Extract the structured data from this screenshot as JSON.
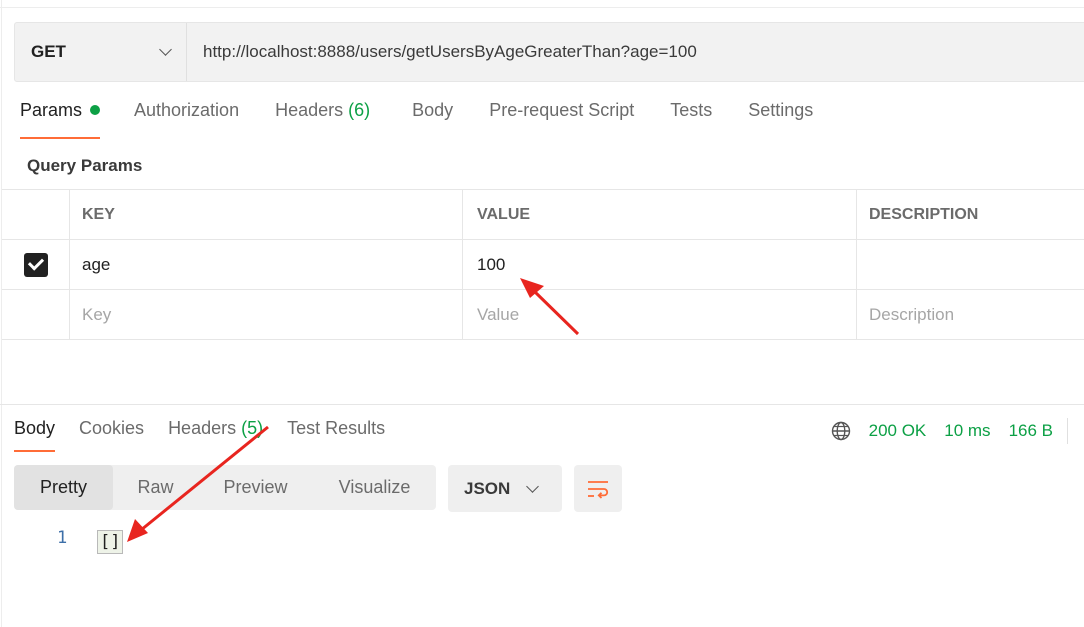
{
  "request": {
    "method": "GET",
    "url": "http://localhost:8888/users/getUsersByAgeGreaterThan?age=100"
  },
  "request_tabs": [
    {
      "label": "Params",
      "active": true,
      "indicator": "green-dot"
    },
    {
      "label": "Authorization"
    },
    {
      "label": "Headers",
      "count": "(6)"
    },
    {
      "label": "Body"
    },
    {
      "label": "Pre-request Script"
    },
    {
      "label": "Tests"
    },
    {
      "label": "Settings"
    }
  ],
  "query_params": {
    "title": "Query Params",
    "headers": {
      "key": "KEY",
      "value": "VALUE",
      "description": "DESCRIPTION"
    },
    "rows": [
      {
        "checked": true,
        "key": "age",
        "value": "100",
        "description": ""
      }
    ],
    "placeholders": {
      "key": "Key",
      "value": "Value",
      "description": "Description"
    }
  },
  "response_tabs": [
    {
      "label": "Body",
      "active": true
    },
    {
      "label": "Cookies"
    },
    {
      "label": "Headers",
      "count": "(5)"
    },
    {
      "label": "Test Results"
    }
  ],
  "response_status": {
    "status": "200 OK",
    "time": "10 ms",
    "size": "166 B"
  },
  "view_modes": [
    "Pretty",
    "Raw",
    "Preview",
    "Visualize"
  ],
  "format": "JSON",
  "response_body": {
    "line_number": "1",
    "content": "[]"
  },
  "colors": {
    "accent": "#ff6c37",
    "success": "#0ca045",
    "annotation": "#e8251f"
  }
}
